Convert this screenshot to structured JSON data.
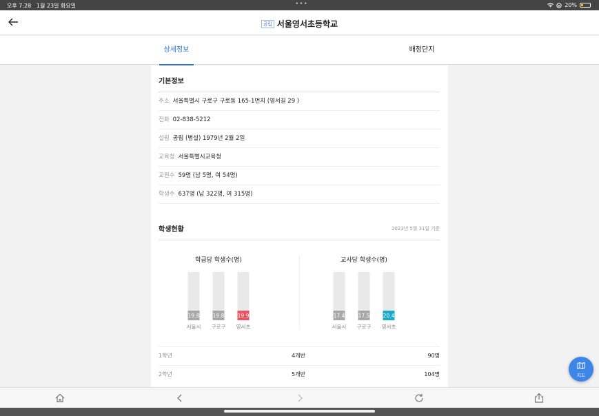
{
  "status_bar": {
    "time": "오후 7:28",
    "date": "1월 23일 화요일",
    "battery": "20%",
    "dots": "•••"
  },
  "header": {
    "badge": "공립",
    "title": "서울영서초등학교"
  },
  "tabs": [
    {
      "label": "상세정보",
      "active": true
    },
    {
      "label": "배정단지",
      "active": false
    }
  ],
  "basic_info": {
    "title": "기본정보",
    "rows": [
      {
        "label": "주소",
        "value": "서울특별시 구로구 구로동 165-1번지 (영서길 29 )"
      },
      {
        "label": "전화",
        "value": "02-838-5212"
      },
      {
        "label": "설립",
        "value": "공립 (병설) 1979년 2월 2일"
      },
      {
        "label": "교육청",
        "value": "서울특별시교육청"
      },
      {
        "label": "교원수",
        "value": "59명 (남 5명, 여 54명)"
      },
      {
        "label": "학생수",
        "value": "637명 (남 322명, 여 315명)"
      }
    ]
  },
  "student_status": {
    "title": "학생현황",
    "as_of": "2023년 5월 31일 기준"
  },
  "chart_data": [
    {
      "type": "bar",
      "title": "학급당 학생수(명)",
      "categories": [
        "서울시",
        "구로구",
        "영서초"
      ],
      "values": [
        19.8,
        19.8,
        19.9
      ],
      "highlight_color": "#e8555f",
      "base_color": "#a8a8a8",
      "track_color": "#e9e9e9"
    },
    {
      "type": "bar",
      "title": "교사당 학생수(명)",
      "categories": [
        "서울시",
        "구로구",
        "영서초"
      ],
      "values": [
        17.4,
        17.5,
        20.4
      ],
      "highlight_color": "#19a9c9",
      "base_color": "#a8a8a8",
      "track_color": "#e9e9e9"
    }
  ],
  "grades": [
    {
      "grade": "1학년",
      "classes": "4개반",
      "students": "90명"
    },
    {
      "grade": "2학년",
      "classes": "5개반",
      "students": "104명"
    }
  ],
  "map_button": {
    "label": "지도"
  },
  "colors": {
    "accent": "#2d6fe0",
    "fab": "#3d86e8"
  },
  "toolbar_icons": [
    "home-icon",
    "back-arrow-icon",
    "forward-arrow-icon",
    "reload-icon",
    "share-icon"
  ]
}
